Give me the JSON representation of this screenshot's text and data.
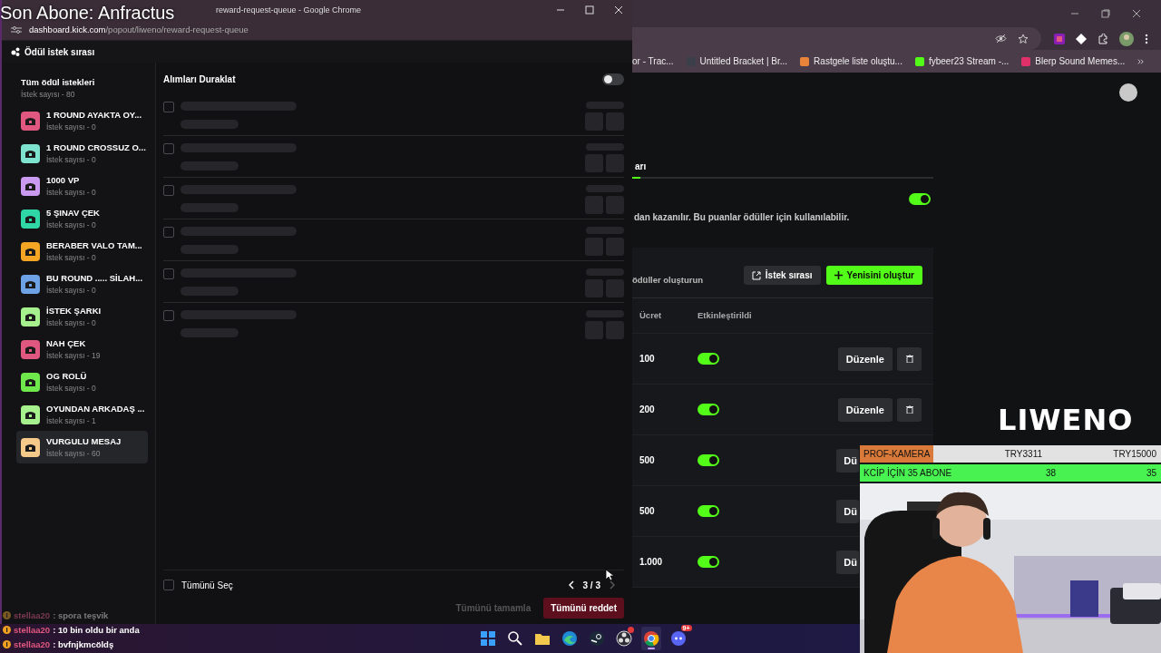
{
  "overlay_title": "Son Abone: Anfractus",
  "popup": {
    "title": "reward-request-queue - Google Chrome",
    "url_host": "dashboard.kick.com",
    "url_path": "/popout/liweno/reward-request-queue",
    "app_title": "Ödül istek sırası",
    "sidebar": {
      "all": {
        "name": "Tüm ödül istekleri",
        "count": "İstek sayısı - 80"
      },
      "items": [
        {
          "name": "1 ROUND AYAKTA OY...",
          "count": "İstek sayısı - 0",
          "color": "#e0577f",
          "selected": false
        },
        {
          "name": "1 ROUND CROSSUZ O...",
          "count": "İstek sayısı - 0",
          "color": "#7de3cf",
          "selected": false
        },
        {
          "name": "1000 VP",
          "count": "İstek sayısı - 0",
          "color": "#c99af0",
          "selected": false
        },
        {
          "name": "5 ŞINAV ÇEK",
          "count": "İstek sayısı - 0",
          "color": "#2fd6a6",
          "selected": false
        },
        {
          "name": "BERABER VALO TAM...",
          "count": "İstek sayısı - 0",
          "color": "#f5a524",
          "selected": false
        },
        {
          "name": "BU ROUND ..... SİLAH...",
          "count": "İstek sayısı - 0",
          "color": "#6ea2e6",
          "selected": false
        },
        {
          "name": "İSTEK ŞARKI",
          "count": "İstek sayısı - 0",
          "color": "#a7f08e",
          "selected": false
        },
        {
          "name": "NAH ÇEK",
          "count": "İstek sayısı - 19",
          "color": "#e0577f",
          "selected": false
        },
        {
          "name": "OG ROLÜ",
          "count": "İstek sayısı - 0",
          "color": "#6ee84a",
          "selected": false
        },
        {
          "name": "OYUNDAN ARKADAŞ ...",
          "count": "İstek sayısı - 1",
          "color": "#a7f08e",
          "selected": false
        },
        {
          "name": "VURGULU MESAJ",
          "count": "İstek sayısı - 60",
          "color": "#f5c98a",
          "selected": true
        }
      ]
    },
    "pause": {
      "label": "Alımları Duraklat",
      "on": false
    },
    "requests": [
      {
        "checked": false
      },
      {
        "checked": false
      },
      {
        "checked": false
      },
      {
        "checked": false
      },
      {
        "checked": false
      },
      {
        "checked": false
      }
    ],
    "select_all": {
      "label": "Tümünü Seç",
      "checked": false
    },
    "pagination": {
      "label": "3 / 3",
      "prev_disabled": false,
      "next_disabled": true
    },
    "actions": [
      {
        "label": "Tümünü tamamla",
        "kind": "ghost",
        "disabled": true
      },
      {
        "label": "Tümünü reddet",
        "kind": "danger",
        "disabled": false
      }
    ]
  },
  "background_window": {
    "bookmarks": [
      {
        "label": "or - Trac..."
      },
      {
        "label": "Untitled Bracket | Br...",
        "color": "#3a3f4a"
      },
      {
        "label": "Rastgele liste oluştu...",
        "color": "#e8833a"
      },
      {
        "label": "fybeer23 Stream -...",
        "color": "#53fc18"
      },
      {
        "label": "Blerp Sound Memes...",
        "color": "#e0306a"
      }
    ],
    "tab": {
      "label": "arı",
      "selected": true
    },
    "feature_on": true,
    "description": "dan kazanılır. Bu puanlar ödüller için kullanılabilir.",
    "subtitle": "ödüller oluşturun",
    "buttons": [
      {
        "label": "İstek sırası",
        "kind": "secondary"
      },
      {
        "label": "Yenisini oluştur",
        "kind": "primary"
      }
    ],
    "columns": [
      "Ücret",
      "Etkinleştirildi"
    ],
    "rows": [
      {
        "cost": "100",
        "enabled": true,
        "edit": "Düzenle",
        "has_delete": true
      },
      {
        "cost": "200",
        "enabled": true,
        "edit": "Düzenle",
        "has_delete": true
      },
      {
        "cost": "500",
        "enabled": true,
        "edit": "Dü",
        "has_delete": false
      },
      {
        "cost": "500",
        "enabled": true,
        "edit": "Dü",
        "has_delete": false
      },
      {
        "cost": "1.000",
        "enabled": true,
        "edit": "Dü",
        "has_delete": false
      }
    ]
  },
  "stream": {
    "logo": "LIWENO",
    "bars": [
      {
        "label": "PROF-KAMERA",
        "value": "TRY3311",
        "goal": "TRY15000",
        "kind": "grey"
      },
      {
        "label": "KCİP İÇİN 35 ABONE",
        "value": "38",
        "goal": "35",
        "kind": "green"
      }
    ],
    "chat": [
      {
        "user": "stellaa20",
        "message": " : spora teşvik",
        "faded": true
      },
      {
        "user": "stellaa20",
        "message": " : 10 bin oldu bir anda",
        "faded": false
      },
      {
        "user": "stellaa20",
        "message": " : bvfnjkmcöldş",
        "faded": false
      }
    ]
  },
  "taskbar": [
    {
      "kind": "windows",
      "active": false
    },
    {
      "kind": "search",
      "active": false
    },
    {
      "kind": "folder",
      "active": false
    },
    {
      "kind": "edge",
      "active": false
    },
    {
      "kind": "steam",
      "active": false
    },
    {
      "kind": "obs",
      "active": false,
      "alert": true
    },
    {
      "kind": "chrome",
      "active": true
    },
    {
      "kind": "discord",
      "active": false,
      "badge": "9+"
    }
  ]
}
